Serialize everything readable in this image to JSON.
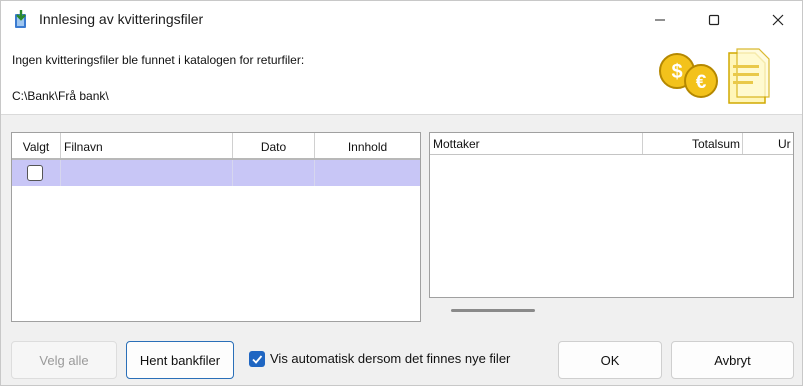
{
  "window": {
    "title": "Innlesing av kvitteringsfiler"
  },
  "header": {
    "message": "Ingen kvitteringsfiler ble funnet i katalogen for returfiler:",
    "path": "C:\\Bank\\Frå bank\\"
  },
  "left_grid": {
    "columns": [
      "Valgt",
      "Filnavn",
      "Dato",
      "Innhold"
    ],
    "rows": [
      {
        "valgt": false,
        "filnavn": "",
        "dato": "",
        "innhold": ""
      }
    ]
  },
  "right_grid": {
    "columns": [
      "Mottaker",
      "Totalsum",
      "Ur"
    ]
  },
  "footer": {
    "velg_alle": "Velg alle",
    "hent_bankfiler": "Hent bankfiler",
    "auto_label": "Vis automatisk dersom det finnes nye filer",
    "auto_checked": true,
    "ok": "OK",
    "avbryt": "Avbryt"
  },
  "colors": {
    "selected_row": "#c8c6f6",
    "accent": "#1f66c2"
  },
  "icons": [
    "download-arrow-icon",
    "minimize-icon",
    "maximize-icon",
    "close-icon",
    "coins-document-icon",
    "checkmark-icon"
  ]
}
